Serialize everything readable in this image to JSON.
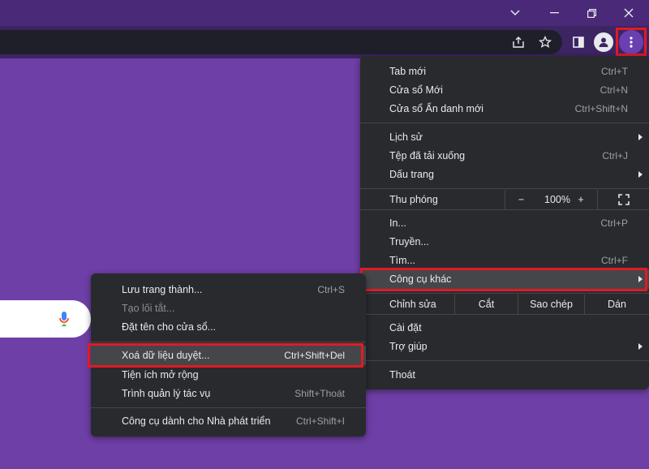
{
  "titlebar": {
    "minimize_icon": "chevron-down-icon",
    "window_icons": [
      "minimize-icon",
      "restore-icon",
      "close-icon"
    ]
  },
  "toolbar": {
    "share_icon": "share-icon",
    "bookmark_icon": "star-icon",
    "sidepanel_icon": "side-panel-icon",
    "profile_icon": "profile-icon",
    "menu_icon": "kebab-menu-icon"
  },
  "search": {
    "mic_icon": "microphone-icon"
  },
  "main_menu": {
    "new_tab": {
      "label": "Tab mới",
      "shortcut": "Ctrl+T"
    },
    "new_window": {
      "label": "Cửa sổ Mới",
      "shortcut": "Ctrl+N"
    },
    "incognito": {
      "label": "Cửa sổ Ẩn danh mới",
      "shortcut": "Ctrl+Shift+N"
    },
    "history": {
      "label": "Lịch sử"
    },
    "downloads": {
      "label": "Tệp đã tải xuống",
      "shortcut": "Ctrl+J"
    },
    "bookmarks": {
      "label": "Dấu trang"
    },
    "zoom": {
      "label": "Thu phóng",
      "minus": "−",
      "value": "100%",
      "plus": "+"
    },
    "print": {
      "label": "In...",
      "shortcut": "Ctrl+P"
    },
    "cast": {
      "label": "Truyền..."
    },
    "find": {
      "label": "Tìm...",
      "shortcut": "Ctrl+F"
    },
    "more_tools": {
      "label": "Công cụ khác"
    },
    "edit": {
      "label": "Chỉnh sửa",
      "cut": "Cắt",
      "copy": "Sao chép",
      "paste": "Dán"
    },
    "settings": {
      "label": "Cài đặt"
    },
    "help": {
      "label": "Trợ giúp"
    },
    "exit": {
      "label": "Thoát"
    }
  },
  "sub_menu": {
    "save_page": {
      "label": "Lưu trang thành...",
      "shortcut": "Ctrl+S"
    },
    "create_shortcut": {
      "label": "Tạo lối tắt..."
    },
    "name_window": {
      "label": "Đặt tên cho cửa sổ..."
    },
    "clear_data": {
      "label": "Xoá dữ liệu duyệt...",
      "shortcut": "Ctrl+Shift+Del"
    },
    "extensions": {
      "label": "Tiện ích mở rộng"
    },
    "task_manager": {
      "label": "Trình quản lý tác vụ",
      "shortcut": "Shift+Thoát"
    },
    "dev_tools": {
      "label": "Công cụ dành cho Nhà phát triển",
      "shortcut": "Ctrl+Shift+I"
    }
  },
  "colors": {
    "page_bg": "#6e3fa6",
    "menu_bg": "#292a2d",
    "highlight": "#e01b24",
    "hover_bg": "#45464a"
  }
}
